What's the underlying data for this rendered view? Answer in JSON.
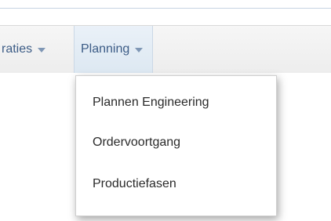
{
  "nav": {
    "prev_label": "raties",
    "prev_caret_icon": "caret-down-icon",
    "planning_label": "Planning",
    "planning_caret_icon": "caret-down-icon"
  },
  "dropdown": {
    "items": [
      {
        "label": "Plannen Engineering"
      },
      {
        "label": "Ordervoortgang"
      },
      {
        "label": "Productiefasen"
      }
    ]
  },
  "colors": {
    "nav_text": "#3c5c86",
    "menu_text": "#2a2a2a",
    "active_tab_bg": "#dde8f2"
  }
}
